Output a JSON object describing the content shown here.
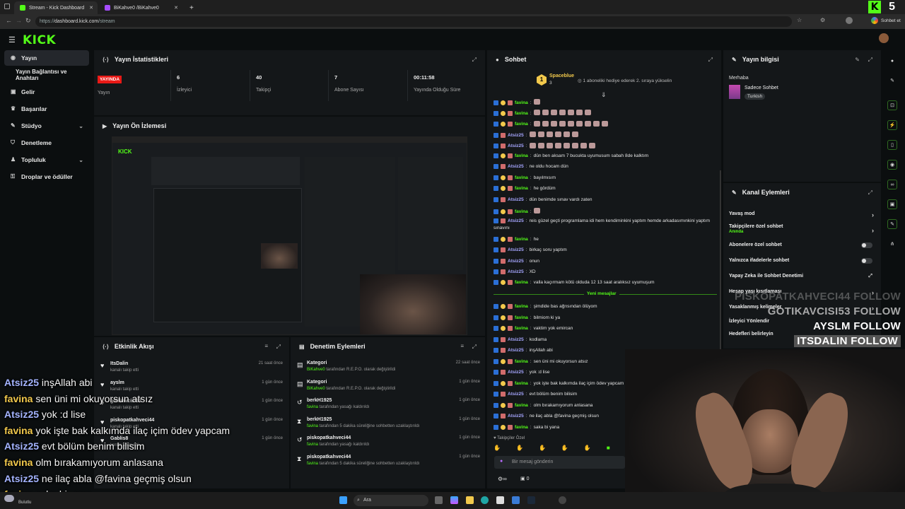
{
  "browser": {
    "tabs": [
      {
        "title": "Stream - Kick Dashboard",
        "color": "#53fc18"
      },
      {
        "title": "BiKahve0 /BiKahve0",
        "color": "#a64dff"
      }
    ],
    "new_tab": "+",
    "url_prefix": "https://",
    "url_host": "dashboard.kick.com",
    "url_path": "/stream",
    "chat_button": "Sohbet et"
  },
  "brand": {
    "logo": "KICK",
    "accent": "#53fc18"
  },
  "sidebar": {
    "items": [
      {
        "label": "Yayın",
        "icon": "broadcast-icon",
        "active": true
      },
      {
        "label": "Yayın Bağlantısı ve Anahtarı",
        "sub": true
      },
      {
        "label": "Gelir",
        "icon": "wallet-icon"
      },
      {
        "label": "Başarılar",
        "icon": "trophy-icon"
      },
      {
        "label": "Stüdyo",
        "icon": "studio-icon",
        "expand": true
      },
      {
        "label": "Denetleme",
        "icon": "shield-icon"
      },
      {
        "label": "Topluluk",
        "icon": "community-icon",
        "expand": true
      },
      {
        "label": "Droplar ve ödüller",
        "icon": "gift-icon"
      }
    ]
  },
  "stats": {
    "title": "Yayın İstatistikleri",
    "badge": "YAYINDA",
    "live_label": "Yayın",
    "items": [
      {
        "value": "6",
        "label": "İzleyici"
      },
      {
        "value": "40",
        "label": "Takipçi"
      },
      {
        "value": "7",
        "label": "Abone Sayısı"
      },
      {
        "value": "00:11:58",
        "label": "Yayında Olduğu Süre"
      }
    ]
  },
  "preview": {
    "title": "Yayın Ön İzlemesi"
  },
  "chat": {
    "title": "Sohbet",
    "pinned_user": "Spaceblue",
    "pinned_count": "3",
    "pinned_text": "1 aboneliki hediye ederek 2. sıraya yükselin",
    "messages": [
      {
        "user": "favina",
        "text": "",
        "emotes": 1
      },
      {
        "user": "favina",
        "text": "",
        "emotes": 7
      },
      {
        "user": "favina",
        "text": "",
        "emotes": 9
      },
      {
        "user": "Atsiz25",
        "text": "",
        "emotes": 6
      },
      {
        "user": "Atsiz25",
        "text": "",
        "emotes": 8
      },
      {
        "user": "favina",
        "text": "dün ben aksam 7 bucukta uyumusum sabah 8de kalktım"
      },
      {
        "user": "Atsiz25",
        "text": "ne oldu hocam dün"
      },
      {
        "user": "favina",
        "text": "bayılmısım"
      },
      {
        "user": "favina",
        "text": "he gördüm"
      },
      {
        "user": "Atsiz25",
        "text": "dün benimde sınav vardı zaten"
      },
      {
        "user": "favina",
        "text": "",
        "emotes": 1
      },
      {
        "user": "Atsiz25",
        "text": "reis güzel geçti programlama idi hem kendiminkini yaptım hemde arkadasımınkini yaptım"
      },
      {
        "user": "",
        "text": "sınavını"
      },
      {
        "user": "favina",
        "text": "he"
      },
      {
        "user": "Atsiz25",
        "text": "birkaç soru yaptım"
      },
      {
        "user": "Atsiz25",
        "text": "onun"
      },
      {
        "user": "Atsiz25",
        "text": "XD"
      },
      {
        "user": "favina",
        "text": "valla kaçırmam kötü olduda 12 13 saat aralıksız uyumuşum"
      }
    ],
    "new_label": "Yeni mesajlar",
    "new_messages": [
      {
        "user": "favina",
        "text": "şimdide bas ağrısından ölüyom"
      },
      {
        "user": "favina",
        "text": "bilmiom ki ya"
      },
      {
        "user": "favina",
        "text": "vaktim yok emircan"
      },
      {
        "user": "Atsiz25",
        "text": "kodlama"
      },
      {
        "user": "Atsiz25",
        "text": "inşAllah abi"
      },
      {
        "user": "favina",
        "text": "sen üni mi okuyorsun atsız"
      },
      {
        "user": "Atsiz25",
        "text": "yok :d lise"
      },
      {
        "user": "favina",
        "text": "yok işte bak kalkımda ilaç içim ödev yapcam"
      },
      {
        "user": "Atsiz25",
        "text": "evt bölüm benim bilisim"
      },
      {
        "user": "favina",
        "text": "olm bırakamıyorum anlasana"
      },
      {
        "user": "Atsiz25",
        "text": "ne ilaç abla @favina geçmiş olsun"
      },
      {
        "user": "favina",
        "text": "saka bi yana"
      }
    ],
    "followers_only": "Takipçiler Özel",
    "input_placeholder": "Bir mesaj gönderin",
    "footer_count": "0"
  },
  "activity": {
    "title": "Etkinlik Akışı",
    "items": [
      {
        "name": "ItsDalin",
        "desc": "kanalı takip etti",
        "time": "21 saat önce"
      },
      {
        "name": "ayslm",
        "desc": "kanalı takip etti",
        "time": "1 gün önce"
      },
      {
        "name": "gotikavcisi53",
        "desc": "kanalı takip etti",
        "time": "1 gün önce"
      },
      {
        "name": "piskopatkahveci44",
        "desc": "kanalı takip etti",
        "time": "1 gün önce"
      },
      {
        "name": "Gablis8",
        "desc": "kanalı takip etti",
        "time": "1 gün önce"
      }
    ]
  },
  "moderation": {
    "title": "Denetim Eylemleri",
    "items": [
      {
        "name": "Kategori",
        "actor": "BiKahve0",
        "desc": "tarafından R.E.P.O. olarak değiştirildi",
        "time": "22 saat önce",
        "icon": "category-icon"
      },
      {
        "name": "Kategori",
        "actor": "BiKahve0",
        "desc": "tarafından R.E.P.O. olarak değiştirildi",
        "time": "1 gün önce",
        "icon": "category-icon"
      },
      {
        "name": "berkH1925",
        "actor": "favina",
        "desc": "tarafından yasağı kaldırıldı",
        "time": "1 gün önce",
        "icon": "unban-icon"
      },
      {
        "name": "berkH1925",
        "actor": "favina",
        "desc": "tarafından 5 dakika süreliğine sohbetten uzaklaştırıldı",
        "time": "1 gün önce",
        "icon": "timeout-icon"
      },
      {
        "name": "piskopatkahveci44",
        "actor": "favina",
        "desc": "tarafından yasağı kaldırıldı",
        "time": "1 gün önce",
        "icon": "unban-icon"
      },
      {
        "name": "piskopatkahveci44",
        "actor": "favina",
        "desc": "tarafından 5 dakika süreliğine sohbetten uzaklaştırıldı",
        "time": "1 gün önce",
        "icon": "timeout-icon"
      }
    ]
  },
  "stream_info": {
    "title": "Yayın bilgisi",
    "greeting": "Merhaba",
    "stream_title": "Sadece Sohbet",
    "language": "Turkish"
  },
  "channel_actions": {
    "title": "Kanal Eylemleri",
    "items": [
      {
        "label": "Yavaş mod",
        "control": "chevron"
      },
      {
        "label": "Takipçilere özel sohbet",
        "sub": "Anında",
        "control": "chevron"
      },
      {
        "label": "Abonelere özel sohbet",
        "control": "toggle"
      },
      {
        "label": "Yalnızca ifadelerle sohbet",
        "control": "toggle"
      },
      {
        "label": "Yapay Zeka ile Sohbet Denetimi",
        "control": "link"
      },
      {
        "label": "Hesap yaşı kısıtlaması",
        "control": "chevron"
      },
      {
        "label": "Yasaklanmış kelimeler",
        "control": "chevron"
      },
      {
        "label": "İzleyici Yönlendir",
        "control": "none"
      },
      {
        "label": "Hedefleri belirleyin",
        "control": "none"
      }
    ]
  },
  "overlay": {
    "chat": [
      {
        "user": "Atsiz25",
        "text": "inşAllah abi"
      },
      {
        "user": "favina",
        "text": "sen üni mi okuyorsun atsız"
      },
      {
        "user": "Atsiz25",
        "text": "yok :d lise"
      },
      {
        "user": "favina",
        "text": "yok işte bak kalkımda ilaç içim ödev yapcam"
      },
      {
        "user": "Atsiz25",
        "text": "evt bölüm benim bilisim"
      },
      {
        "user": "favina",
        "text": "olm bırakamıyorum anlasana"
      },
      {
        "user": "Atsiz25",
        "text": "ne ilaç abla @favina geçmiş olsun"
      },
      {
        "user": "favina",
        "text": "saka bi yana"
      }
    ],
    "follows": [
      {
        "text": "PISKOPATKAHVECI44  FOLLOW"
      },
      {
        "text": "GOTIKAVCISI53  FOLLOW"
      },
      {
        "text": "AYSLM  FOLLOW"
      },
      {
        "text": "ITSDALIN  FOLLOW"
      }
    ],
    "corner_badge": "5"
  },
  "taskbar": {
    "search": "Ara",
    "weather": "Bulutlu"
  }
}
